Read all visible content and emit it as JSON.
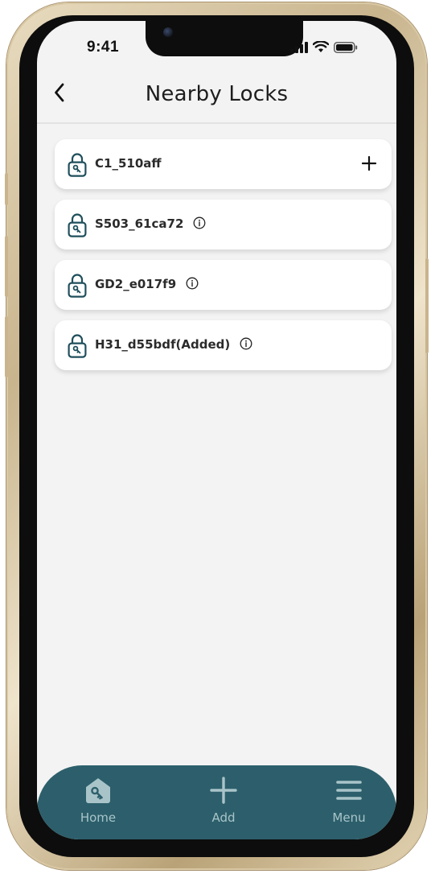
{
  "status_bar": {
    "time": "9:41"
  },
  "header": {
    "title": "Nearby Locks",
    "back_icon": "chevron-left-icon"
  },
  "locks": [
    {
      "name": "C1_510aff",
      "action_icon": "plus-icon"
    },
    {
      "name": "S503_61ca72",
      "action_icon": "info-icon"
    },
    {
      "name": "GD2_e017f9",
      "action_icon": "info-icon"
    },
    {
      "name": "H31_d55bdf(Added)",
      "action_icon": "info-icon"
    }
  ],
  "tab_bar": {
    "tabs": [
      {
        "label": "Home",
        "icon": "home-key-icon"
      },
      {
        "label": "Add",
        "icon": "plus-icon"
      },
      {
        "label": "Menu",
        "icon": "hamburger-menu-icon"
      }
    ]
  },
  "colors": {
    "accent": "#2c5f6b",
    "tab_label": "#a9c4c9",
    "lock_icon": "#1f4f5c",
    "background": "#f3f3f3",
    "card": "#ffffff"
  }
}
